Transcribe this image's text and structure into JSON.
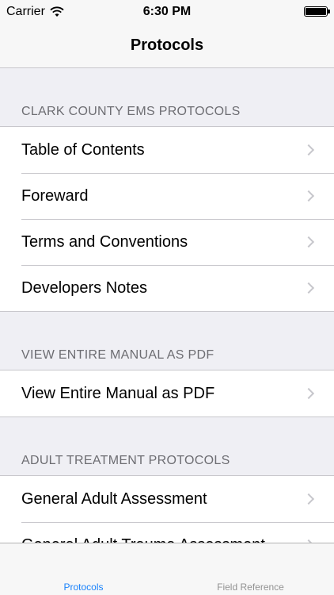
{
  "status_bar": {
    "carrier": "Carrier",
    "time": "6:30 PM"
  },
  "nav": {
    "title": "Protocols"
  },
  "sections": [
    {
      "header": "CLARK COUNTY EMS PROTOCOLS",
      "items": [
        {
          "label": "Table of Contents"
        },
        {
          "label": "Foreward"
        },
        {
          "label": "Terms and Conventions"
        },
        {
          "label": "Developers Notes"
        }
      ]
    },
    {
      "header": "VIEW ENTIRE MANUAL AS PDF",
      "items": [
        {
          "label": "View Entire Manual as PDF"
        }
      ]
    },
    {
      "header": "ADULT TREATMENT PROTOCOLS",
      "items": [
        {
          "label": "General Adult Assessment"
        },
        {
          "label": "General Adult Trauma Assessment"
        }
      ]
    }
  ],
  "tabs": [
    {
      "label": "Protocols",
      "active": true
    },
    {
      "label": "Field Reference",
      "active": false
    }
  ],
  "colors": {
    "accent": "#1a82fb",
    "inactive": "#929292",
    "background": "#efeff4"
  }
}
